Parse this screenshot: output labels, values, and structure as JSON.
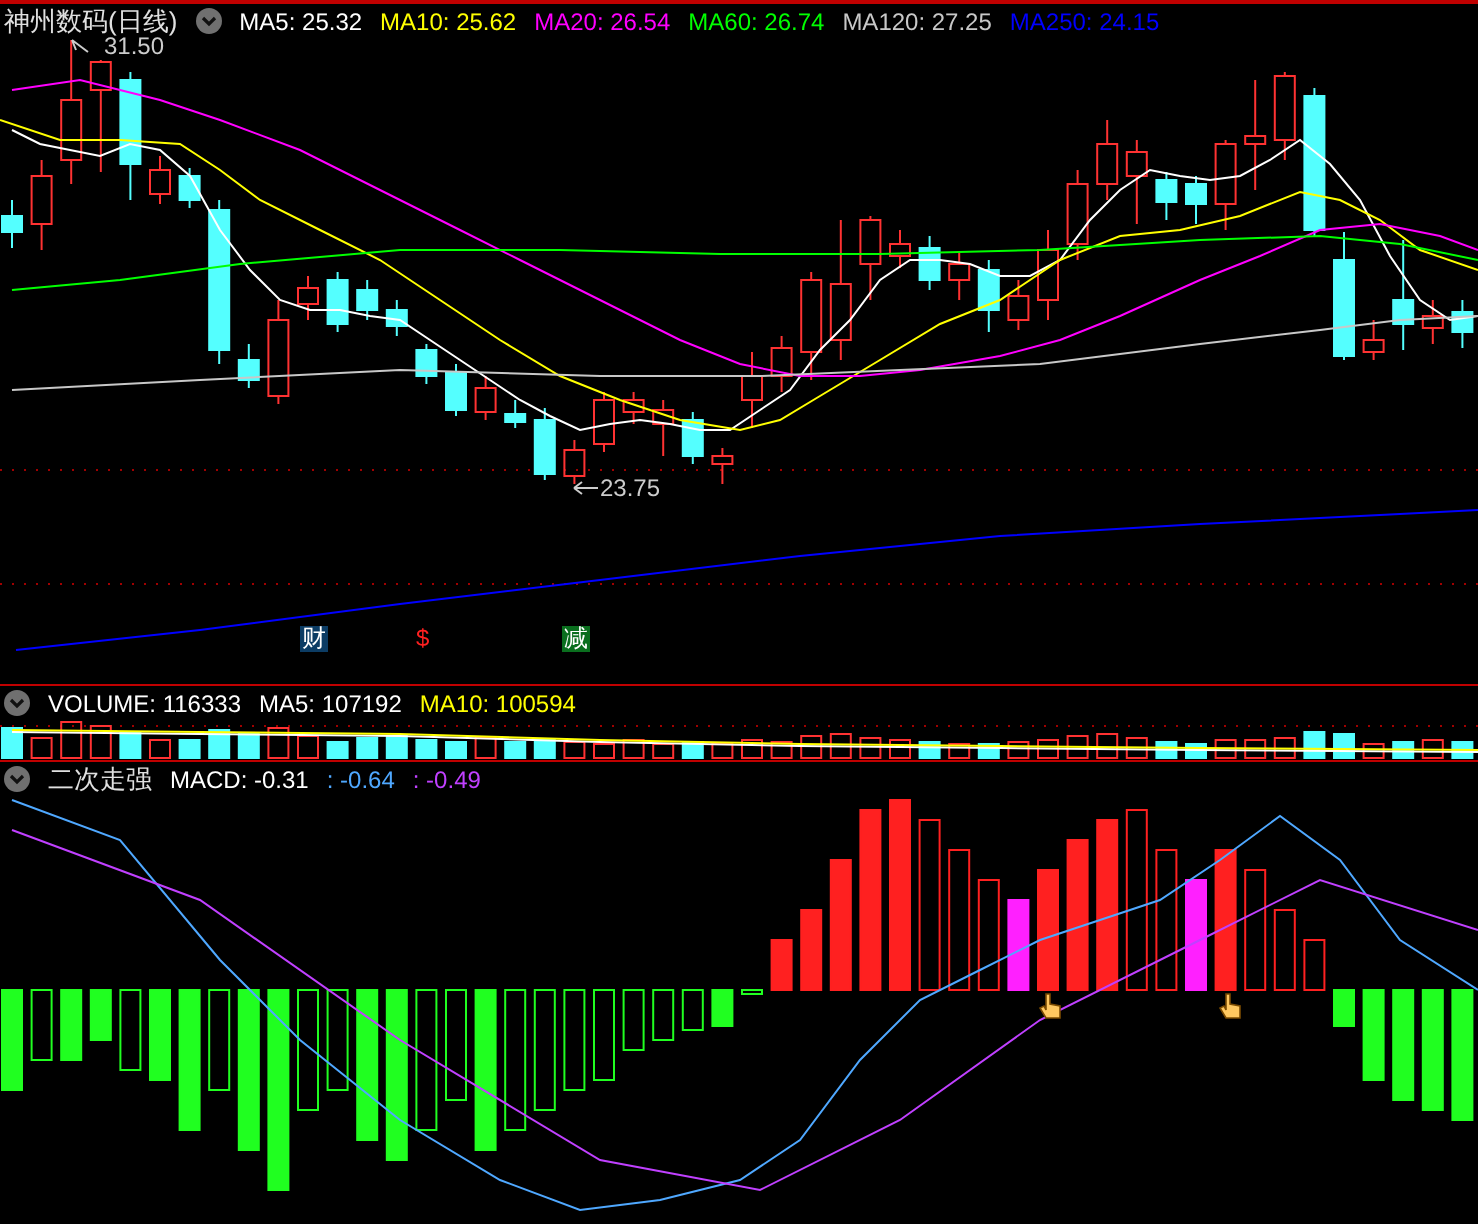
{
  "price_panel": {
    "title": "神州数码(日线)",
    "legend": [
      {
        "label": "MA5: 25.32",
        "color": "#ffffff"
      },
      {
        "label": "MA10: 25.62",
        "color": "#ffff00"
      },
      {
        "label": "MA20: 26.54",
        "color": "#ff00ff"
      },
      {
        "label": "MA60: 26.74",
        "color": "#00ff00"
      },
      {
        "label": "MA120: 27.25",
        "color": "#c8c8c8"
      },
      {
        "label": "MA250: 24.15",
        "color": "#0000ff"
      }
    ],
    "high_label": "31.50",
    "low_label": "23.75",
    "event_markers": [
      {
        "label": "财",
        "color": "#0c3c64"
      },
      {
        "label": "$",
        "color": "#000000"
      },
      {
        "label": "减",
        "color": "#0a6e1e"
      }
    ]
  },
  "volume_panel": {
    "legend": [
      {
        "label": "VOLUME: 116333",
        "color": "#ffffff"
      },
      {
        "label": "MA5: 107192",
        "color": "#ffffff"
      },
      {
        "label": "MA10: 100594",
        "color": "#ffff00"
      }
    ]
  },
  "macd_panel": {
    "title": "二次走强",
    "legend": [
      {
        "label": "MACD: -0.31",
        "color": "#ffffff"
      },
      {
        "label": ": -0.64",
        "color": "#4fa8ff"
      },
      {
        "label": ": -0.49",
        "color": "#c040ff"
      }
    ]
  }
}
